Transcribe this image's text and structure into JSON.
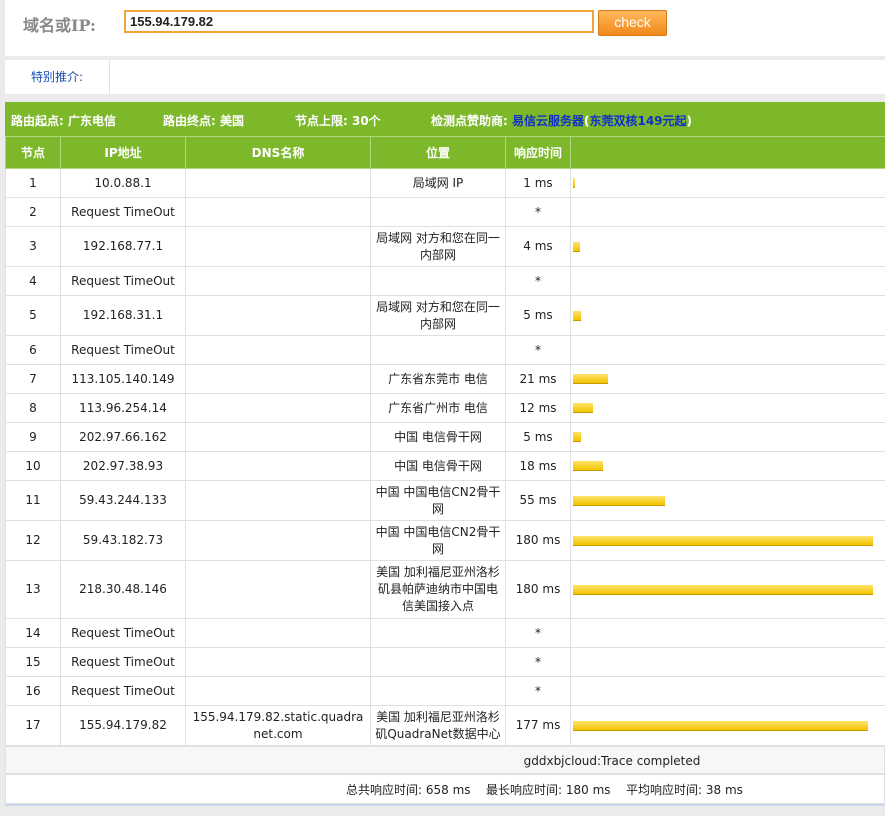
{
  "query": {
    "label": "域名或IP:",
    "value": "155.94.179.82",
    "button": "check"
  },
  "promo": {
    "label": "特别推介:"
  },
  "info": {
    "start": "路由起点: 广东电信",
    "end": "路由终点: 美国",
    "limit": "节点上限: 30个",
    "sponsor_prefix": "检测点赞助商: ",
    "sponsor_name": "易信云服务器",
    "sponsor_open": "(",
    "sponsor_offer": "东莞双核149元起",
    "sponsor_close": ")"
  },
  "table": {
    "headers": [
      "节点",
      "IP地址",
      "DNS名称",
      "位置",
      "响应时间"
    ],
    "rows": [
      {
        "hop": "1",
        "ip": "10.0.88.1",
        "dns": "",
        "location": "局域网 IP",
        "time": "1 ms",
        "ms": 1
      },
      {
        "hop": "2",
        "ip": "Request TimeOut",
        "dns": "",
        "location": "",
        "time": "*",
        "ms": 0
      },
      {
        "hop": "3",
        "ip": "192.168.77.1",
        "dns": "",
        "location": "局域网 对方和您在同一内部网",
        "time": "4 ms",
        "ms": 4
      },
      {
        "hop": "4",
        "ip": "Request TimeOut",
        "dns": "",
        "location": "",
        "time": "*",
        "ms": 0
      },
      {
        "hop": "5",
        "ip": "192.168.31.1",
        "dns": "",
        "location": "局域网 对方和您在同一内部网",
        "time": "5 ms",
        "ms": 5
      },
      {
        "hop": "6",
        "ip": "Request TimeOut",
        "dns": "",
        "location": "",
        "time": "*",
        "ms": 0
      },
      {
        "hop": "7",
        "ip": "113.105.140.149",
        "dns": "",
        "location": "广东省东莞市 电信",
        "time": "21 ms",
        "ms": 21
      },
      {
        "hop": "8",
        "ip": "113.96.254.14",
        "dns": "",
        "location": "广东省广州市 电信",
        "time": "12 ms",
        "ms": 12
      },
      {
        "hop": "9",
        "ip": "202.97.66.162",
        "dns": "",
        "location": "中国 电信骨干网",
        "time": "5 ms",
        "ms": 5
      },
      {
        "hop": "10",
        "ip": "202.97.38.93",
        "dns": "",
        "location": "中国 电信骨干网",
        "time": "18 ms",
        "ms": 18
      },
      {
        "hop": "11",
        "ip": "59.43.244.133",
        "dns": "",
        "location": "中国 中国电信CN2骨干网",
        "time": "55 ms",
        "ms": 55
      },
      {
        "hop": "12",
        "ip": "59.43.182.73",
        "dns": "",
        "location": "中国 中国电信CN2骨干网",
        "time": "180 ms",
        "ms": 180
      },
      {
        "hop": "13",
        "ip": "218.30.48.146",
        "dns": "",
        "location": "美国 加利福尼亚州洛杉矶县帕萨迪纳市中国电信美国接入点",
        "time": "180 ms",
        "ms": 180
      },
      {
        "hop": "14",
        "ip": "Request TimeOut",
        "dns": "",
        "location": "",
        "time": "*",
        "ms": 0
      },
      {
        "hop": "15",
        "ip": "Request TimeOut",
        "dns": "",
        "location": "",
        "time": "*",
        "ms": 0
      },
      {
        "hop": "16",
        "ip": "Request TimeOut",
        "dns": "",
        "location": "",
        "time": "*",
        "ms": 0
      },
      {
        "hop": "17",
        "ip": "155.94.179.82",
        "dns": "155.94.179.82.static.quadranet.com",
        "location": "美国 加利福尼亚州洛杉矶QuadraNet数据中心",
        "time": "177 ms",
        "ms": 177
      }
    ]
  },
  "status": "gddxbjcloud:Trace completed",
  "summary": {
    "total": "总共响应时间:  658 ms",
    "max": "最长响应时间:  180 ms",
    "avg": "平均响应时间:  38 ms"
  },
  "colors": {
    "header_green": "#7db82a",
    "bar_yellow": "#f2c400",
    "button_orange": "#f08a1a",
    "link_blue": "#1030c8"
  }
}
